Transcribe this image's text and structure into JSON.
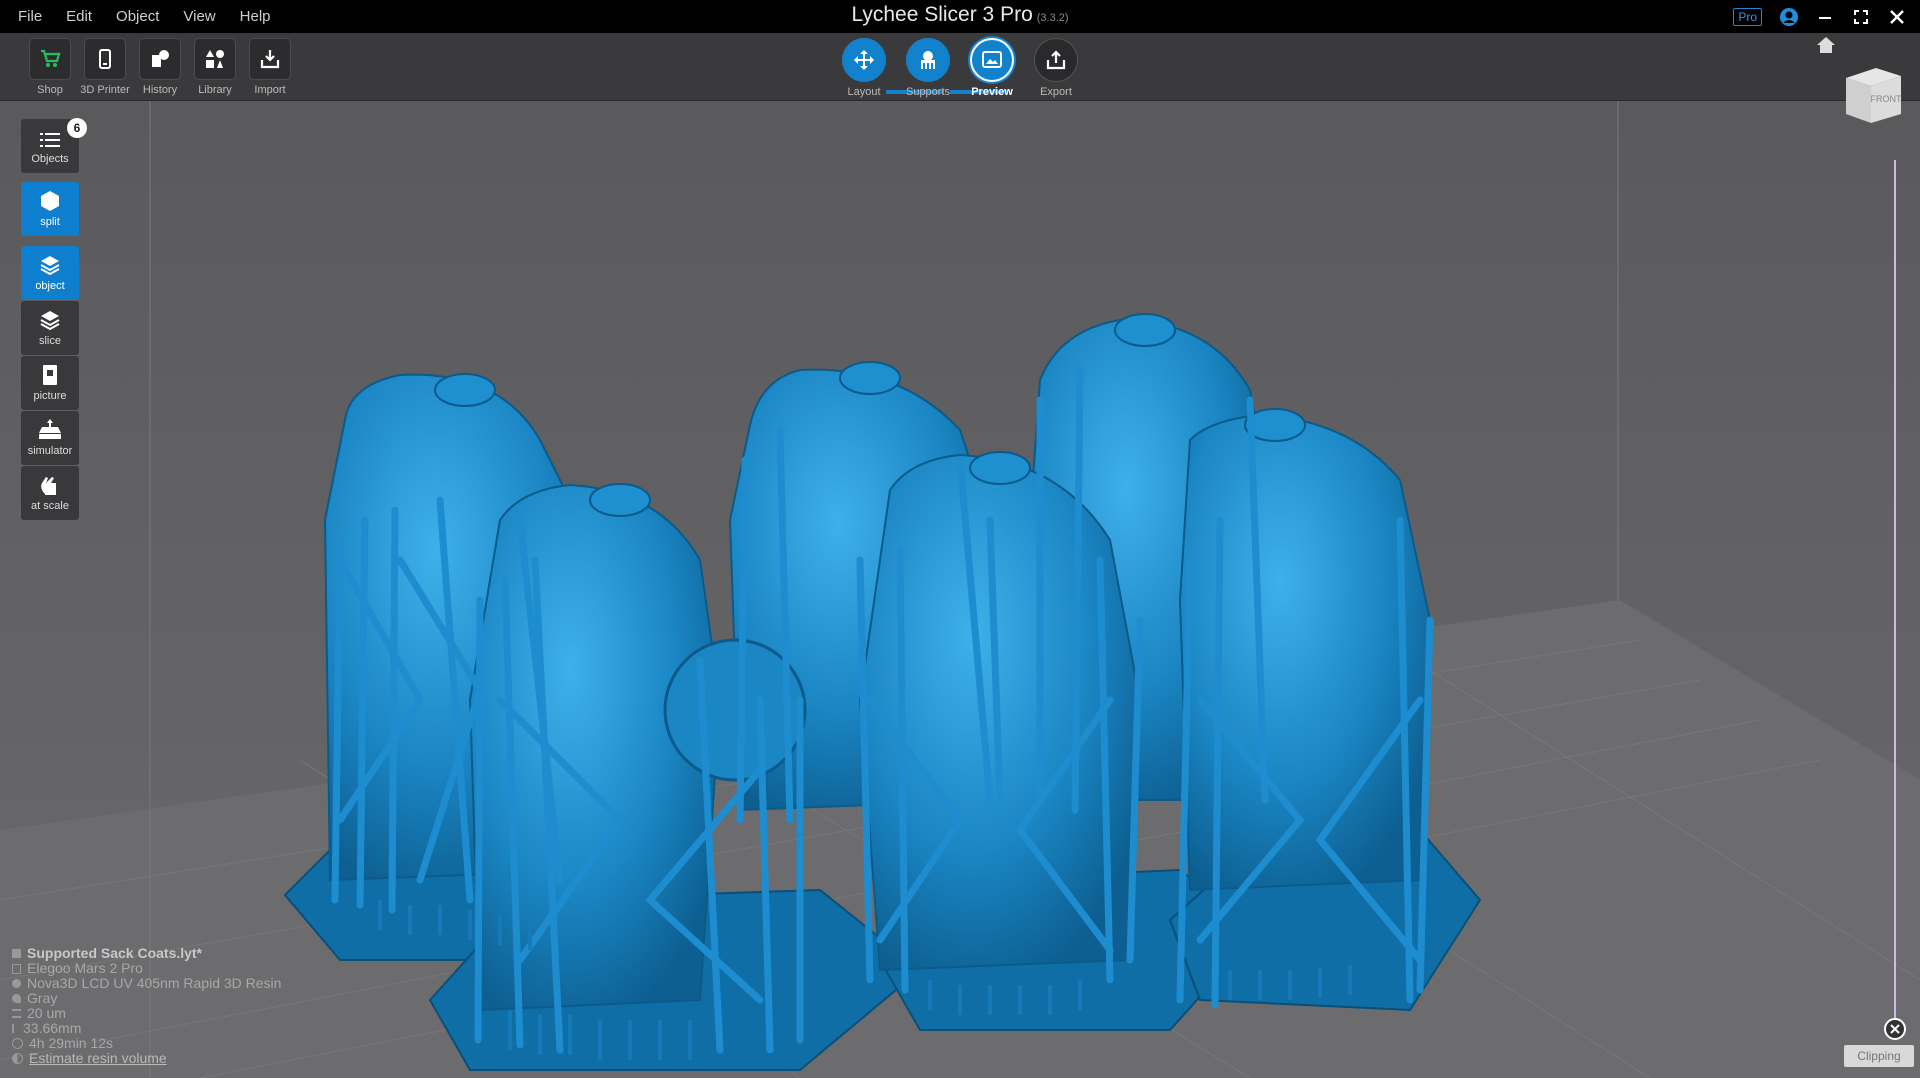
{
  "menu": [
    "File",
    "Edit",
    "Object",
    "View",
    "Help"
  ],
  "app": {
    "title": "Lychee Slicer 3 Pro",
    "version": "(3.3.2)",
    "pro_badge": "Pro"
  },
  "toolbar": {
    "tools": [
      "Shop",
      "3D Printer",
      "History",
      "Library",
      "Import"
    ],
    "steps": [
      "Layout",
      "Supports",
      "Preview",
      "Export"
    ],
    "active_step": "Preview"
  },
  "sidebar": {
    "objects_label": "Objects",
    "objects_count": "6",
    "items": [
      "split",
      "object",
      "slice",
      "picture",
      "simulator",
      "at scale"
    ]
  },
  "view_cube": {
    "face_label": "FRONT"
  },
  "info": {
    "file": "Supported Sack Coats.lyt*",
    "printer": "Elegoo Mars 2 Pro",
    "resin": "Nova3D LCD UV 405nm Rapid 3D Resin",
    "color": "Gray",
    "layer": "20 um",
    "height": "33.66mm",
    "time": "4h 29min 12s",
    "estimate_link": "Estimate resin volume"
  },
  "clipping": {
    "label": "Clipping"
  },
  "colors": {
    "accent": "#1382cc",
    "model": "#1a86c4",
    "viewport": "#5f5f61"
  }
}
